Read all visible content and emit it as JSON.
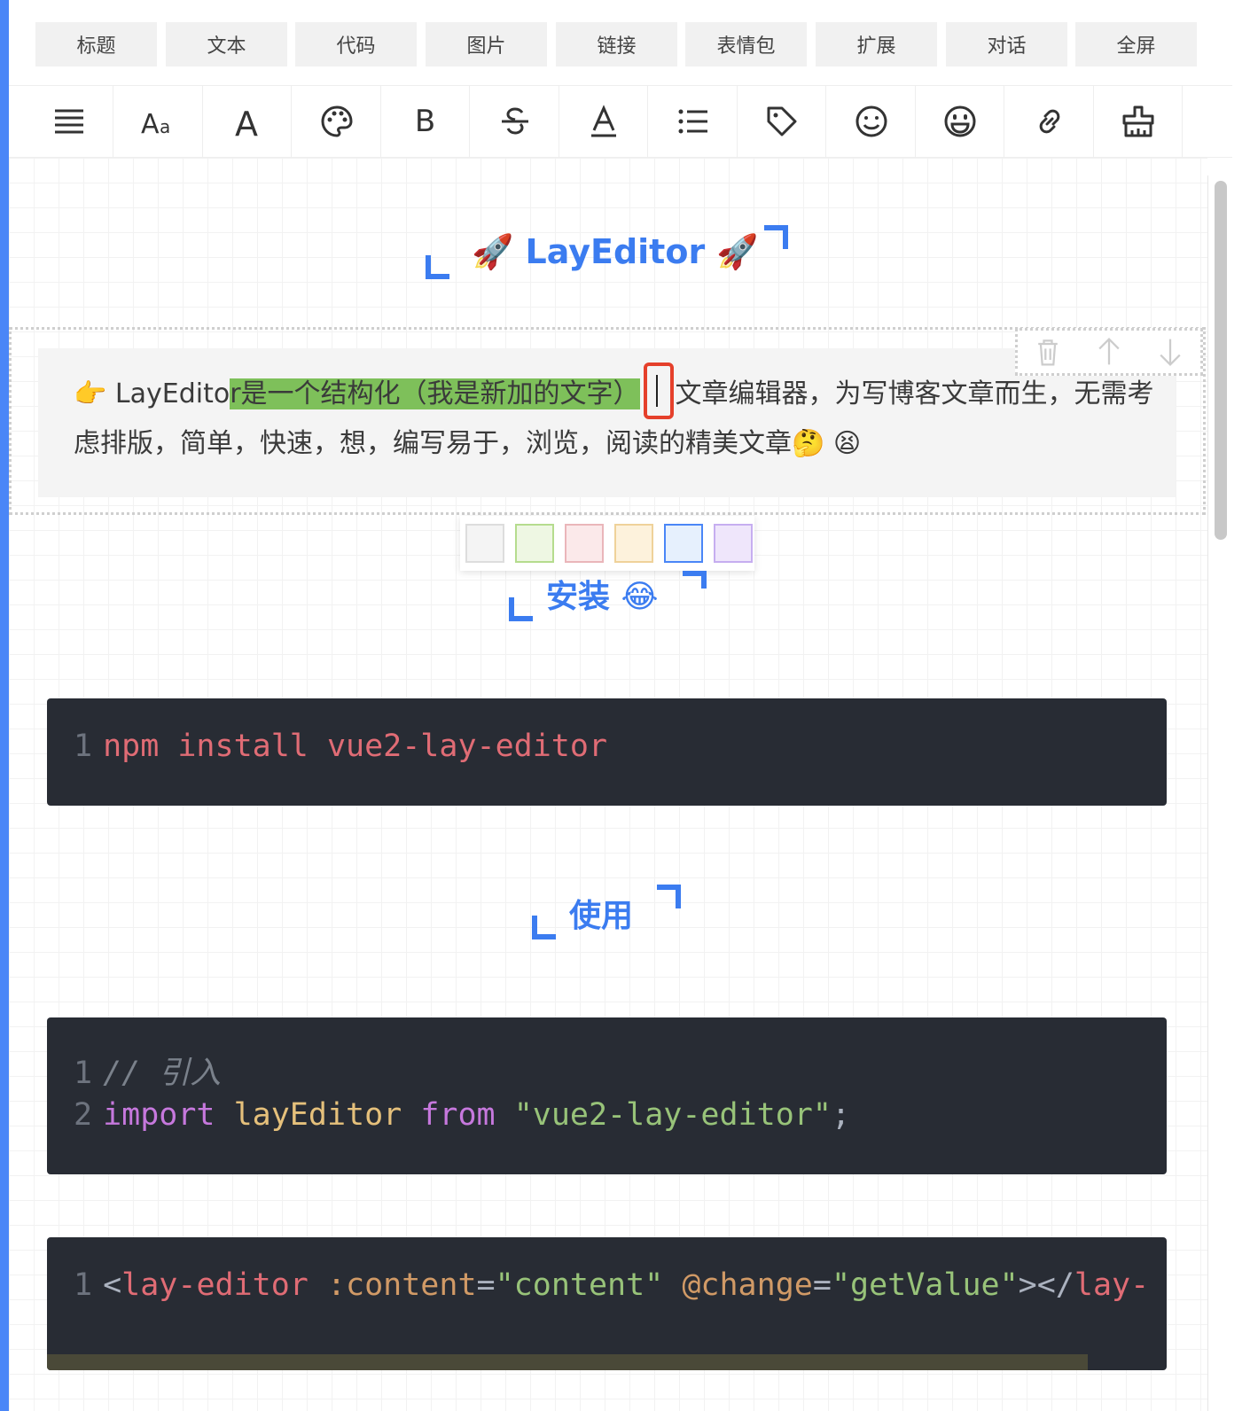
{
  "menu": {
    "items": [
      "标题",
      "文本",
      "代码",
      "图片",
      "链接",
      "表情包",
      "扩展",
      "对话",
      "全屏"
    ]
  },
  "toolbar": {
    "icons": [
      "paragraph-icon",
      "font-size-icon",
      "font-icon",
      "palette-icon",
      "bold-icon",
      "strikethrough-icon",
      "underline-icon",
      "list-icon",
      "tag-icon",
      "smile-icon",
      "emoji-icon",
      "link-icon",
      "clear-format-icon"
    ],
    "bold_label": "B"
  },
  "content": {
    "title": "🚀 LayEditor 🚀",
    "paragraph": {
      "prefix": "👉 LayEdito",
      "highlighted": "r是一个结构化（我是新加的文字）",
      "after_caret": "文章编辑器，为写博客文章而生，无需考虑排版，简单，快速，想，编写易于，浏览，阅读的精美文章🤔 😫"
    },
    "install_heading": "安装 😂",
    "usage_heading": "使用",
    "code1": {
      "line_number": "1",
      "text": "npm install vue2-lay-editor"
    },
    "code2": {
      "line1_number": "1",
      "line1": "// 引入",
      "line2_number": "2",
      "line2_kw1": "import",
      "line2_name": "layEditor",
      "line2_kw2": "from",
      "line2_str": "\"vue2-lay-editor\"",
      "line2_end": ";"
    },
    "code3": {
      "line_number": "1",
      "lt": "<",
      "tag": "lay-editor",
      "attr1": ":content",
      "eq1": "=",
      "val1": "\"content\"",
      "attr2": "@change",
      "eq2": "=",
      "val2": "\"getValue\"",
      "close": "></",
      "tag2": "lay-"
    }
  },
  "colors": {
    "accent": "#3b7cf0",
    "highlight": "#7ec05a",
    "swatches": [
      "#f4f4f4",
      "#eef7e3",
      "#fbe9ea",
      "#fdf2dc",
      "#e6f0fd",
      "#efe6fb"
    ]
  }
}
